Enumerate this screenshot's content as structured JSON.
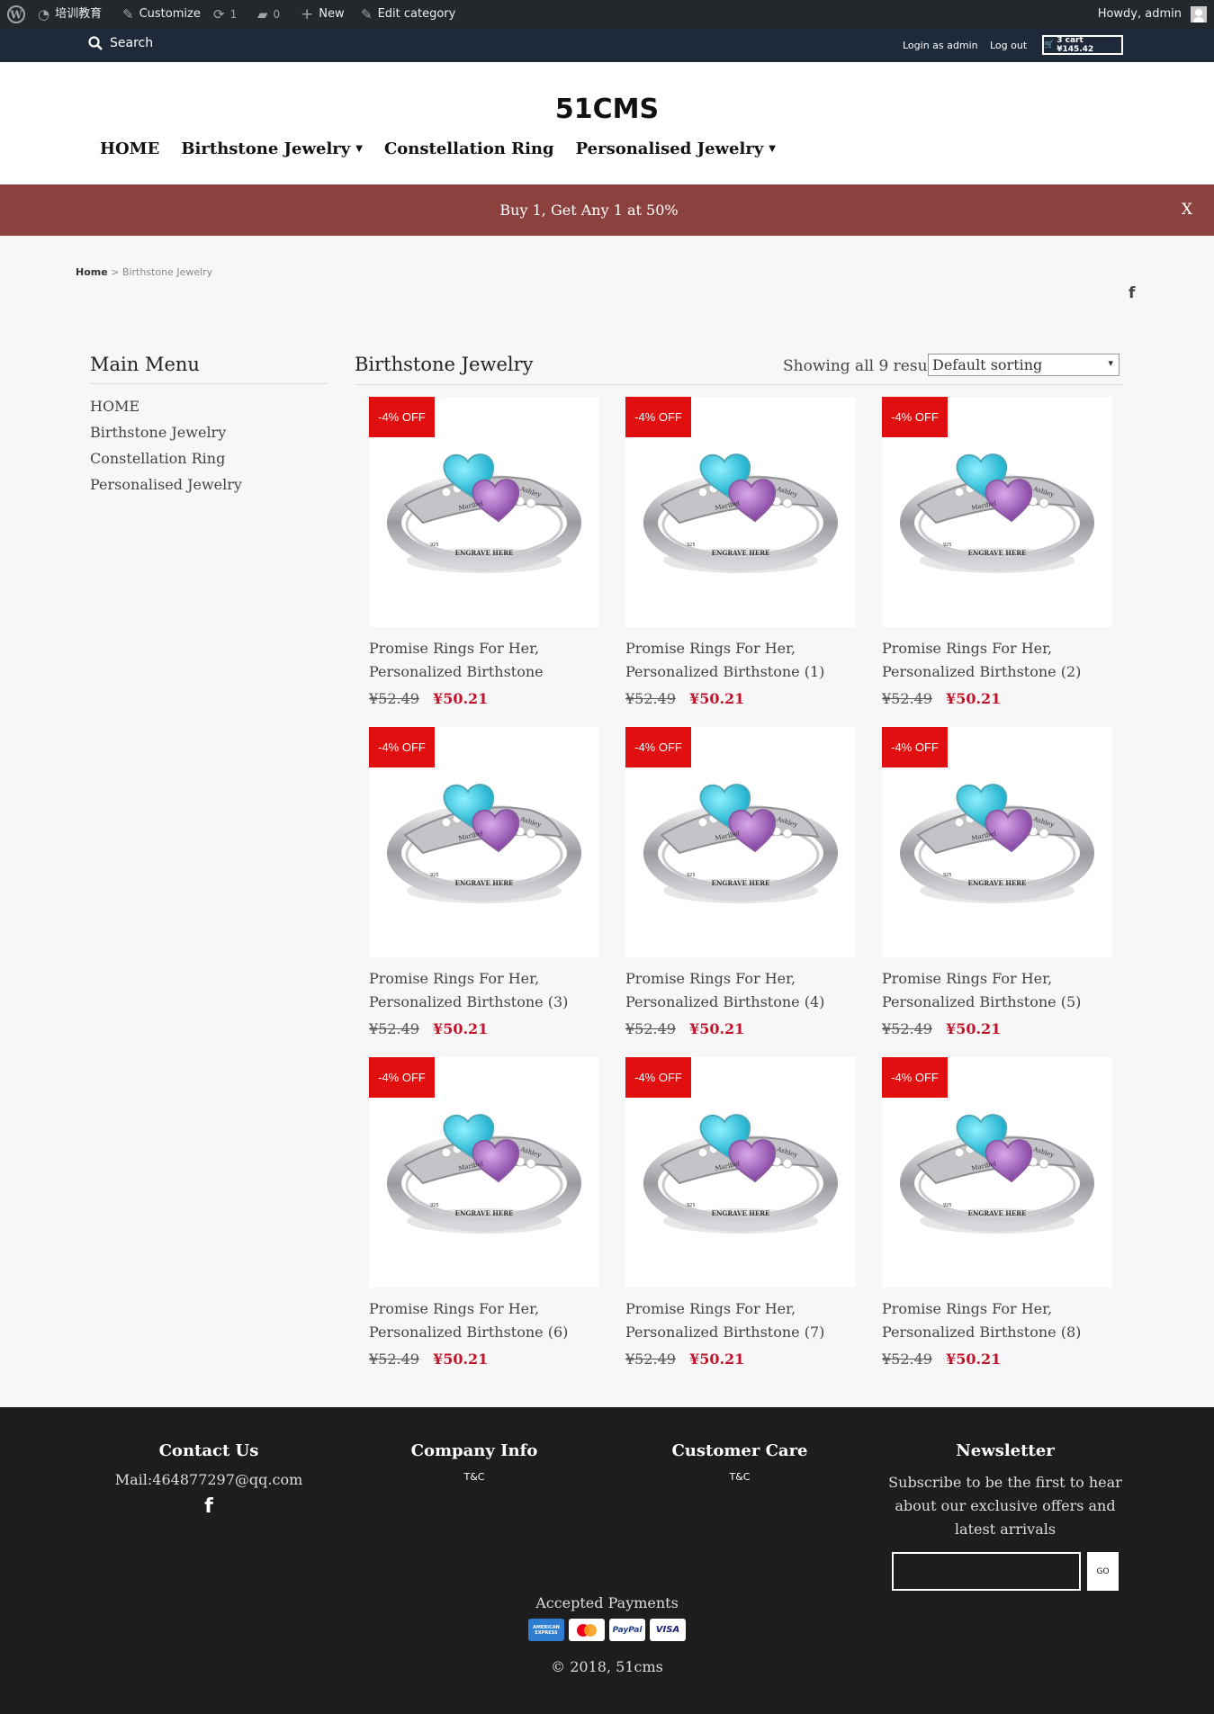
{
  "admin_bar": {
    "site_name": "培训教育",
    "customize": "Customize",
    "updates": "1",
    "comments": "0",
    "new": "New",
    "edit": "Edit category",
    "howdy": "Howdy, admin"
  },
  "top_bar": {
    "search": "Search",
    "login_as": "Login as admin",
    "logout": "Log out",
    "cart": "3 cart ¥145.42"
  },
  "header": {
    "site_title": "51CMS",
    "nav": [
      {
        "label": "HOME",
        "dropdown": false
      },
      {
        "label": "Birthstone Jewelry",
        "dropdown": true
      },
      {
        "label": "Constellation Ring",
        "dropdown": false
      },
      {
        "label": "Personalised Jewelry",
        "dropdown": true
      }
    ]
  },
  "promo": {
    "text": "Buy 1, Get Any 1 at 50%",
    "close": "X"
  },
  "breadcrumb": {
    "home": "Home",
    "sep": ">",
    "current": "Birthstone Jewelry"
  },
  "sidebar": {
    "title": "Main Menu",
    "items": [
      "HOME",
      "Birthstone Jewelry",
      "Constellation Ring",
      "Personalised Jewelry"
    ]
  },
  "main": {
    "title": "Birthstone Jewelry",
    "result_count": "Showing all 9 results",
    "sort": "Default sorting",
    "products": [
      {
        "badge": "-4% OFF",
        "name_1": "Promise Rings For Her,",
        "name_2": "Personalized Birthstone",
        "old_price": "¥52.49",
        "price": "¥50.21"
      },
      {
        "badge": "-4% OFF",
        "name_1": "Promise Rings For Her,",
        "name_2": "Personalized Birthstone (1)",
        "old_price": "¥52.49",
        "price": "¥50.21"
      },
      {
        "badge": "-4% OFF",
        "name_1": "Promise Rings For Her,",
        "name_2": "Personalized Birthstone (2)",
        "old_price": "¥52.49",
        "price": "¥50.21"
      },
      {
        "badge": "-4% OFF",
        "name_1": "Promise Rings For Her,",
        "name_2": "Personalized Birthstone (3)",
        "old_price": "¥52.49",
        "price": "¥50.21"
      },
      {
        "badge": "-4% OFF",
        "name_1": "Promise Rings For Her,",
        "name_2": "Personalized Birthstone (4)",
        "old_price": "¥52.49",
        "price": "¥50.21"
      },
      {
        "badge": "-4% OFF",
        "name_1": "Promise Rings For Her,",
        "name_2": "Personalized Birthstone (5)",
        "old_price": "¥52.49",
        "price": "¥50.21"
      },
      {
        "badge": "-4% OFF",
        "name_1": "Promise Rings For Her,",
        "name_2": "Personalized Birthstone (6)",
        "old_price": "¥52.49",
        "price": "¥50.21"
      },
      {
        "badge": "-4% OFF",
        "name_1": "Promise Rings For Her,",
        "name_2": "Personalized Birthstone (7)",
        "old_price": "¥52.49",
        "price": "¥50.21"
      },
      {
        "badge": "-4% OFF",
        "name_1": "Promise Rings For Her,",
        "name_2": "Personalized Birthstone (8)",
        "old_price": "¥52.49",
        "price": "¥50.21"
      }
    ]
  },
  "footer": {
    "contact": {
      "title": "Contact Us",
      "mail": "Mail:464877297@qq.com"
    },
    "company": {
      "title": "Company Info",
      "link": "T&C"
    },
    "care": {
      "title": "Customer Care",
      "link": "T&C"
    },
    "newsletter": {
      "title": "Newsletter",
      "line1": "Subscribe to be the first to hear",
      "line2": "about our exclusive offers and",
      "line3": "latest arrivals",
      "button": "GO"
    },
    "payments_label": "Accepted Payments",
    "cards": [
      "AMERICAN EXPRESS",
      "mastercard",
      "PayPal",
      "VISA"
    ],
    "copyright": "© 2018, 51cms"
  },
  "colors": {
    "admin_bar": "#23282d",
    "top_bar": "#1e2a3a",
    "promo": "#8b423f",
    "badge": "#e10f0f",
    "price": "#c0142b",
    "footer": "#1d1d1d"
  }
}
